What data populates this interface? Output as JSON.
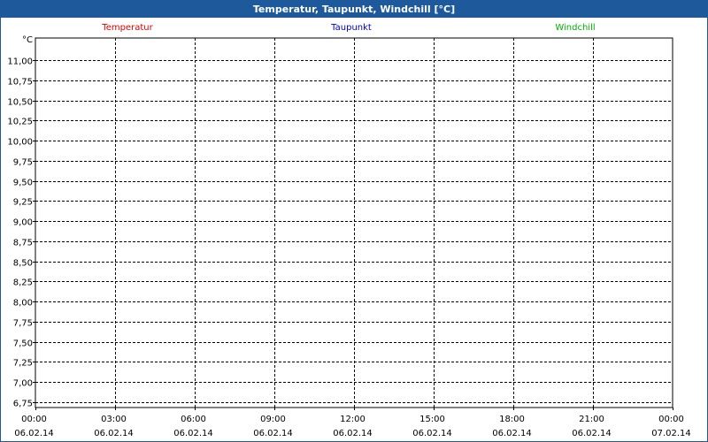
{
  "window": {
    "title": "Temperatur, Taupunkt, Windchill [°C]"
  },
  "colors": {
    "title_bar": "#1e5a9b",
    "temperatur": "#e00000",
    "taupunkt": "#0000c0",
    "windchill": "#00b000",
    "grid": "#000000"
  },
  "chart_data": {
    "type": "line",
    "title": "Temperatur, Taupunkt, Windchill [°C]",
    "ylabel": "°C",
    "xlabel": "",
    "ylim": [
      6.7,
      11.3
    ],
    "yticks": [
      "11,00",
      "10,75",
      "10,50",
      "10,25",
      "10,00",
      "9,75",
      "9,50",
      "9,25",
      "9,00",
      "8,75",
      "8,50",
      "8,25",
      "8,00",
      "7,75",
      "7,50",
      "7,25",
      "7,00",
      "6,75"
    ],
    "ytick_values": [
      11.0,
      10.75,
      10.5,
      10.25,
      10.0,
      9.75,
      9.5,
      9.25,
      9.0,
      8.75,
      8.5,
      8.25,
      8.0,
      7.75,
      7.5,
      7.25,
      7.0,
      6.75
    ],
    "xticks": [
      {
        "time": "00:00",
        "date": "06.02.14"
      },
      {
        "time": "03:00",
        "date": "06.02.14"
      },
      {
        "time": "06:00",
        "date": "06.02.14"
      },
      {
        "time": "09:00",
        "date": "06.02.14"
      },
      {
        "time": "12:00",
        "date": "06.02.14"
      },
      {
        "time": "15:00",
        "date": "06.02.14"
      },
      {
        "time": "18:00",
        "date": "06.02.14"
      },
      {
        "time": "21:00",
        "date": "06.02.14"
      },
      {
        "time": "00:00",
        "date": "07.02.14"
      }
    ],
    "grid": true,
    "legend_position": "top",
    "series": [
      {
        "name": "Temperatur",
        "color": "#e00000",
        "values": []
      },
      {
        "name": "Taupunkt",
        "color": "#0000c0",
        "values": []
      },
      {
        "name": "Windchill",
        "color": "#00b000",
        "values": []
      }
    ]
  }
}
